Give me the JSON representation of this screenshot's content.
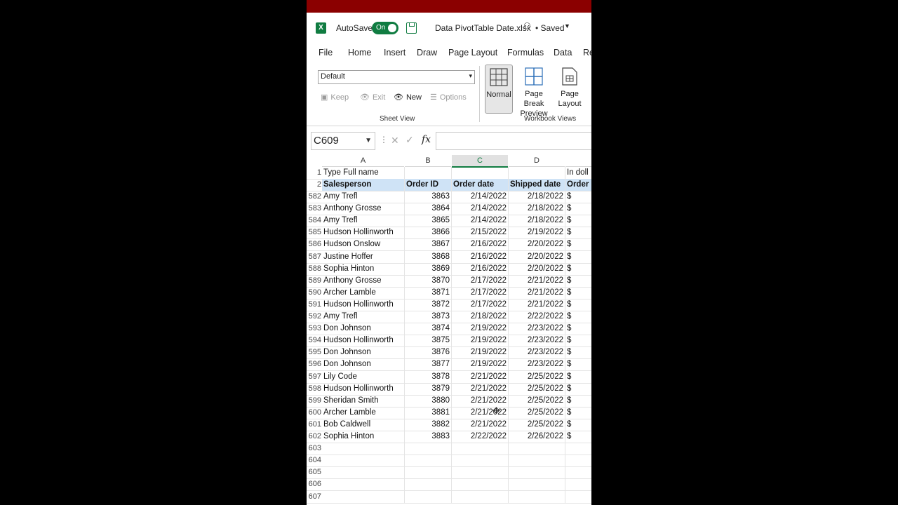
{
  "titlebar": {
    "autosave_label": "AutoSave",
    "autosave_state": "On",
    "filename": "Data PivotTable Date.xlsx",
    "status": "• Saved"
  },
  "menu": [
    "File",
    "Home",
    "Insert",
    "Draw",
    "Page Layout",
    "Formulas",
    "Data",
    "Re"
  ],
  "ribbon": {
    "sheet_view_value": "Default",
    "keep": "Keep",
    "exit": "Exit",
    "new": "New",
    "options": "Options",
    "sheet_view_label": "Sheet View",
    "normal": "Normal",
    "page_break_1": "Page Break",
    "page_break_2": "Preview",
    "page_layout_1": "Page",
    "page_layout_2": "Layout",
    "workbook_views_label": "Workbook Views"
  },
  "formula_bar": {
    "name_box": "C609",
    "fx": "fx"
  },
  "columns": [
    "A",
    "B",
    "C",
    "D"
  ],
  "sheet": {
    "row1": {
      "num": "1",
      "a": "Type Full name",
      "e": "In doll"
    },
    "row2": {
      "num": "2",
      "a": "Salesperson",
      "b": "Order ID",
      "c": "Order date",
      "d": "Shipped date",
      "e": "Order"
    },
    "rows": [
      [
        "582",
        "Amy Trefl",
        "3863",
        "2/14/2022",
        "2/18/2022",
        "$"
      ],
      [
        "583",
        "Anthony Grosse",
        "3864",
        "2/14/2022",
        "2/18/2022",
        "$"
      ],
      [
        "584",
        "Amy Trefl",
        "3865",
        "2/14/2022",
        "2/18/2022",
        "$"
      ],
      [
        "585",
        "Hudson Hollinworth",
        "3866",
        "2/15/2022",
        "2/19/2022",
        "$"
      ],
      [
        "586",
        "Hudson Onslow",
        "3867",
        "2/16/2022",
        "2/20/2022",
        "$"
      ],
      [
        "587",
        "Justine Hoffer",
        "3868",
        "2/16/2022",
        "2/20/2022",
        "$"
      ],
      [
        "588",
        "Sophia Hinton",
        "3869",
        "2/16/2022",
        "2/20/2022",
        "$"
      ],
      [
        "589",
        "Anthony Grosse",
        "3870",
        "2/17/2022",
        "2/21/2022",
        "$"
      ],
      [
        "590",
        "Archer Lamble",
        "3871",
        "2/17/2022",
        "2/21/2022",
        "$"
      ],
      [
        "591",
        "Hudson Hollinworth",
        "3872",
        "2/17/2022",
        "2/21/2022",
        "$"
      ],
      [
        "592",
        "Amy Trefl",
        "3873",
        "2/18/2022",
        "2/22/2022",
        "$"
      ],
      [
        "593",
        "Don Johnson",
        "3874",
        "2/19/2022",
        "2/23/2022",
        "$"
      ],
      [
        "594",
        "Hudson Hollinworth",
        "3875",
        "2/19/2022",
        "2/23/2022",
        "$"
      ],
      [
        "595",
        "Don Johnson",
        "3876",
        "2/19/2022",
        "2/23/2022",
        "$"
      ],
      [
        "596",
        "Don Johnson",
        "3877",
        "2/19/2022",
        "2/23/2022",
        "$"
      ],
      [
        "597",
        "Lily Code",
        "3878",
        "2/21/2022",
        "2/25/2022",
        "$"
      ],
      [
        "598",
        "Hudson Hollinworth",
        "3879",
        "2/21/2022",
        "2/25/2022",
        "$"
      ],
      [
        "599",
        "Sheridan Smith",
        "3880",
        "2/21/2022",
        "2/25/2022",
        "$"
      ],
      [
        "600",
        "Archer Lamble",
        "3881",
        "2/21/2022",
        "2/25/2022",
        "$"
      ],
      [
        "601",
        "Bob Caldwell",
        "3882",
        "2/21/2022",
        "2/25/2022",
        "$"
      ],
      [
        "602",
        "Sophia Hinton",
        "3883",
        "2/22/2022",
        "2/26/2022",
        "$"
      ],
      [
        "603",
        "",
        "",
        "",
        "",
        ""
      ],
      [
        "604",
        "",
        "",
        "",
        "",
        ""
      ],
      [
        "605",
        "",
        "",
        "",
        "",
        ""
      ],
      [
        "606",
        "",
        "",
        "",
        "",
        ""
      ],
      [
        "607",
        "",
        "",
        "",
        "",
        ""
      ]
    ]
  }
}
